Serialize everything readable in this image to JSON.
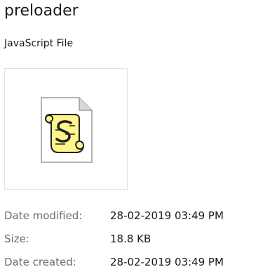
{
  "file": {
    "name": "preloader",
    "type": "JavaScript File",
    "icon": "javascript-script-file-icon"
  },
  "properties": [
    {
      "label": "Date modified:",
      "value": "28-02-2019 03:49 PM"
    },
    {
      "label": "Size:",
      "value": "18.8 KB"
    },
    {
      "label": "Date created:",
      "value": "28-02-2019 03:49 PM"
    }
  ],
  "colors": {
    "scroll_fill": "#fff8a8",
    "scroll_stroke": "#202020",
    "page_fill": "#ffffff",
    "page_fold": "#c8c8c8"
  }
}
